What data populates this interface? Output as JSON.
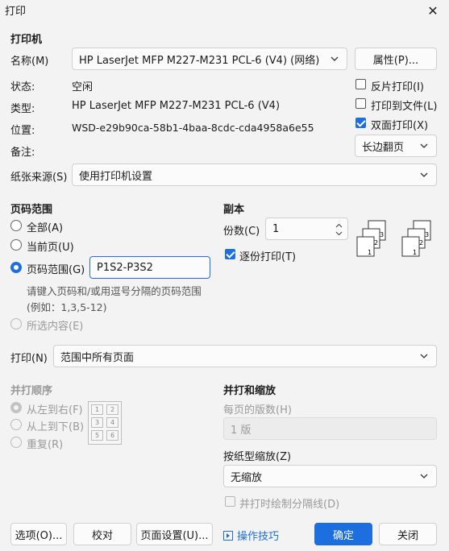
{
  "window": {
    "title": "打印"
  },
  "printer": {
    "section": "打印机",
    "name_label": "名称(M)",
    "name_value": "HP LaserJet MFP M227-M231 PCL-6 (V4) (网络)",
    "properties_button": "属性(P)...",
    "status_label": "状态:",
    "status_value": "空闲",
    "type_label": "类型:",
    "type_value": "HP LaserJet MFP M227-M231 PCL-6 (V4)",
    "location_label": "位置:",
    "location_value": "WSD-e29b90ca-58b1-4baa-8cdc-cda4958a6e55",
    "note_label": "备注:",
    "reverse_print": "反片打印(I)",
    "print_to_file": "打印到文件(L)",
    "duplex": "双面打印(X)",
    "flip": "长边翻页",
    "paper_source_label": "纸张来源(S)",
    "paper_source_value": "使用打印机设置"
  },
  "page_range": {
    "section": "页码范围",
    "all": "全部(A)",
    "current": "当前页(U)",
    "range": "页码范围(G)",
    "range_value": "P1S2-P3S2",
    "hint1": "请键入页码和/或用逗号分隔的页码范围",
    "hint2": "(例如：1,3,5-12)",
    "selection": "所选内容(E)"
  },
  "copies": {
    "section": "副本",
    "count_label": "份数(C)",
    "count_value": "1",
    "collate": "逐份打印(T)"
  },
  "print_what": {
    "label": "打印(N)",
    "value": "范围中所有页面"
  },
  "print_order": {
    "section": "并打顺序",
    "ltr": "从左到右(F)",
    "ttb": "从上到下(B)",
    "repeat": "重复(R)",
    "grid": [
      "1",
      "2",
      "3",
      "4",
      "5",
      "6"
    ]
  },
  "zoom": {
    "section": "并打和缩放",
    "pages_per_sheet_label": "每页的版数(H)",
    "pages_per_sheet_value": "1 版",
    "scale_label": "按纸型缩放(Z)",
    "scale_value": "无缩放",
    "draw_lines": "并打时绘制分隔线(D)"
  },
  "footer": {
    "options": "选项(O)...",
    "proofread": "校对",
    "page_setup": "页面设置(U)...",
    "tips": "操作技巧",
    "ok": "确定",
    "close": "关闭"
  },
  "colors": {
    "accent": "#1d6fe0"
  }
}
